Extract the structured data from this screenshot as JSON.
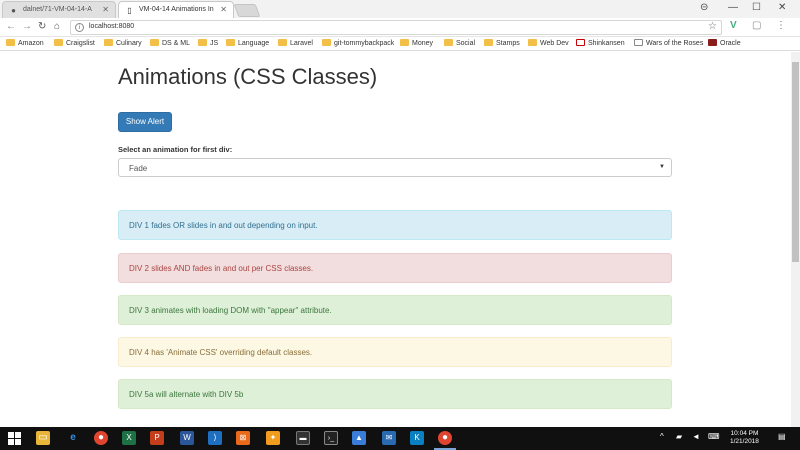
{
  "browser": {
    "tabs": [
      {
        "title": "dalnet/71-VM-04-14-A",
        "icon": "github-icon",
        "active": false
      },
      {
        "title": "VM-04-14 Animations In",
        "icon": "page-icon",
        "active": true
      }
    ],
    "window_controls": [
      "profile-icon",
      "minimize-icon",
      "maximize-icon",
      "close-icon"
    ],
    "url": "localhost:8080",
    "bookmarks": [
      "Amazon",
      "Craigslist",
      "Culinary",
      "DS & ML",
      "JS",
      "Language",
      "Laravel",
      "git-tommybackpack",
      "Money",
      "Social",
      "Stamps",
      "Web Dev",
      "Shinkansen",
      "Wars of the Roses",
      "Oracle"
    ]
  },
  "page": {
    "title": "Animations (CSS Classes)",
    "alert_button": "Show Alert",
    "select_label": "Select an animation for first div:",
    "select_value": "Fade",
    "alerts": [
      {
        "text": "DIV 1 fades OR slides in and out depending on input.",
        "style": "info"
      },
      {
        "text": "DIV 2 slides AND fades in and out per CSS classes.",
        "style": "danger"
      },
      {
        "text": "DIV 3 animates with loading DOM with \"appear\" attribute.",
        "style": "success"
      },
      {
        "text": "DIV 4 has 'Animate CSS' overriding default classes.",
        "style": "warning"
      },
      {
        "text": "DIV 5a will alternate with DIV 5b",
        "style": "success"
      }
    ]
  },
  "taskbar": {
    "time": "10:04 PM",
    "date": "1/21/2018"
  },
  "colors": {
    "primary": "#337ab7",
    "info_bg": "#d9edf7",
    "danger_bg": "#f2dede",
    "success_bg": "#dff0d8",
    "warning_bg": "#fcf8e3"
  }
}
